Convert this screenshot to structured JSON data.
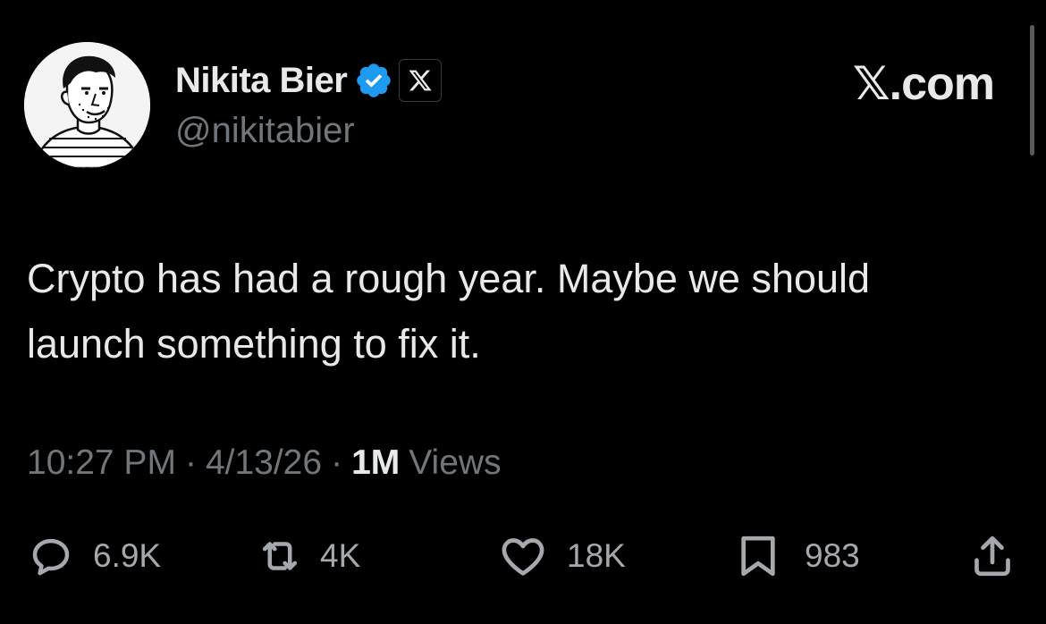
{
  "author": {
    "display_name": "Nikita Bier",
    "handle": "@nikitabier",
    "verified": true,
    "affiliation_badge": "x-logo-icon"
  },
  "brand": "𝕏.com",
  "tweet": {
    "text": "Crypto has had a rough year. Maybe we should launch something to fix it."
  },
  "meta": {
    "time": "10:27 PM",
    "separator": "·",
    "date": "4/13/26",
    "views_count": "1M",
    "views_label": "Views"
  },
  "actions": {
    "replies": "6.9K",
    "reposts": "4K",
    "likes": "18K",
    "bookmarks": "983"
  },
  "icons": [
    "reply-icon",
    "repost-icon",
    "like-icon",
    "bookmark-icon",
    "share-icon",
    "verified-badge-icon",
    "x-logo-icon"
  ],
  "colors": {
    "background": "#000000",
    "primary_text": "#e7e9ea",
    "secondary_text": "#71767b",
    "verified_blue": "#1d9bf0"
  }
}
